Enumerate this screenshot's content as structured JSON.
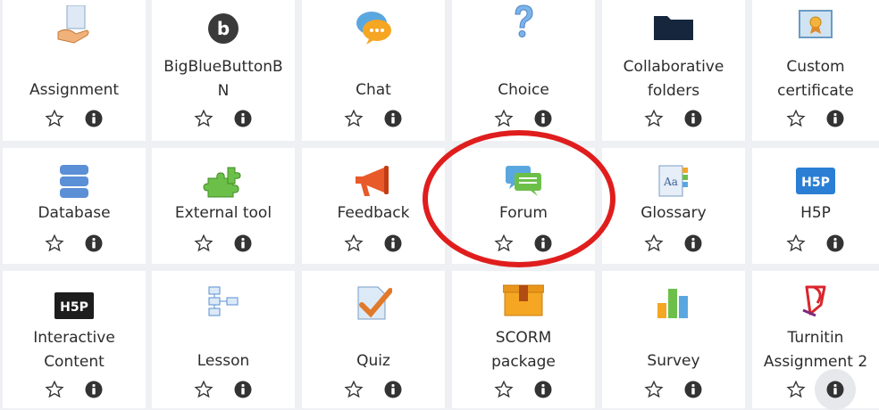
{
  "activities": [
    {
      "label": "Assignment",
      "icon": "assignment-icon"
    },
    {
      "label": "BigBlueButtonB\nN",
      "icon": "bigbluebutton-icon"
    },
    {
      "label": "Chat",
      "icon": "chat-icon"
    },
    {
      "label": "Choice",
      "icon": "choice-icon"
    },
    {
      "label": "Collaborative\nfolders",
      "icon": "folder-icon"
    },
    {
      "label": "Custom\ncertificate",
      "icon": "certificate-icon"
    },
    {
      "label": "Database",
      "icon": "database-icon"
    },
    {
      "label": "External tool",
      "icon": "puzzle-icon"
    },
    {
      "label": "Feedback",
      "icon": "megaphone-icon"
    },
    {
      "label": "Forum",
      "icon": "forum-icon"
    },
    {
      "label": "Glossary",
      "icon": "glossary-icon"
    },
    {
      "label": "H5P",
      "icon": "h5p-icon"
    },
    {
      "label": "Interactive\nContent",
      "icon": "h5p-dark-icon"
    },
    {
      "label": "Lesson",
      "icon": "lesson-icon"
    },
    {
      "label": "Quiz",
      "icon": "quiz-icon"
    },
    {
      "label": "SCORM\npackage",
      "icon": "scorm-icon"
    },
    {
      "label": "Survey",
      "icon": "survey-icon"
    },
    {
      "label": "Turnitin\nAssignment 2",
      "icon": "turnitin-icon"
    }
  ],
  "icon_text": {
    "bigbluebutton": "b",
    "h5p": "H5P",
    "glossary": "Aa"
  },
  "colors": {
    "highlight_ring": "#e01d1d",
    "tile_bg": "#ffffff",
    "page_bg": "#eef0f3"
  }
}
